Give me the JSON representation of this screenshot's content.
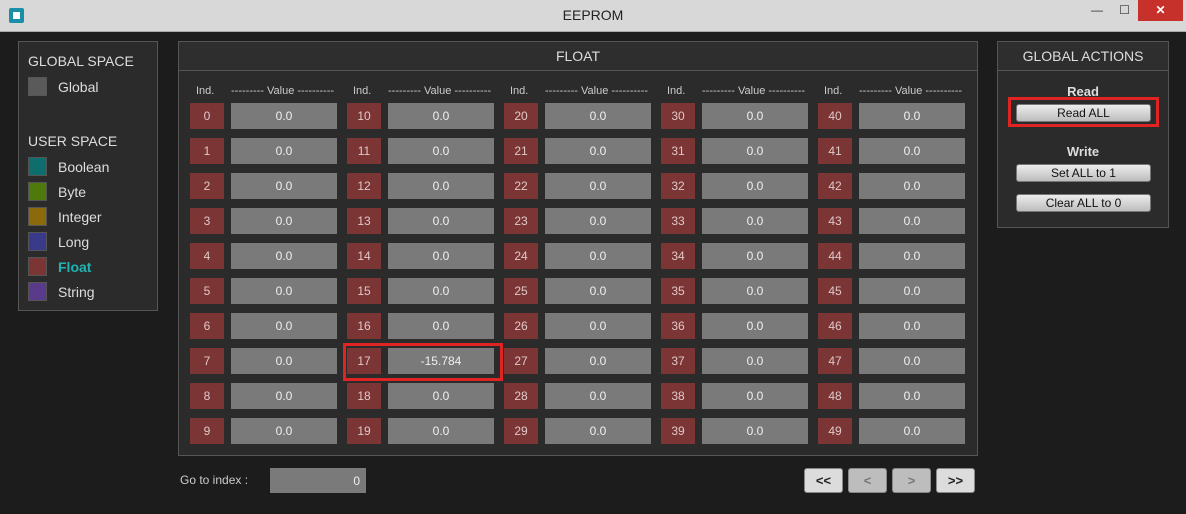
{
  "window": {
    "title": "EEPROM",
    "min_glyph": "—",
    "max_glyph": "☐",
    "close_glyph": "✕"
  },
  "left": {
    "global_title": "GLOBAL SPACE",
    "global_items": [
      {
        "label": "Global",
        "color": "#5a5a5a"
      }
    ],
    "user_title": "USER SPACE",
    "user_items": [
      {
        "label": "Boolean",
        "color": "#0e6e6e"
      },
      {
        "label": "Byte",
        "color": "#4e7a0c"
      },
      {
        "label": "Integer",
        "color": "#8a6a0a"
      },
      {
        "label": "Long",
        "color": "#3a3a8a"
      },
      {
        "label": "Float",
        "color": "#7b3535",
        "active": true
      },
      {
        "label": "String",
        "color": "#5a3a8a"
      }
    ]
  },
  "float_panel": {
    "title": "FLOAT",
    "col_ind_header": "Ind.",
    "col_value_header": "--------- Value ----------",
    "columns": [
      {
        "ind": [
          "0",
          "1",
          "2",
          "3",
          "4",
          "5",
          "6",
          "7",
          "8",
          "9"
        ],
        "values": [
          "0.0",
          "0.0",
          "0.0",
          "0.0",
          "0.0",
          "0.0",
          "0.0",
          "0.0",
          "0.0",
          "0.0"
        ]
      },
      {
        "ind": [
          "10",
          "11",
          "12",
          "13",
          "14",
          "15",
          "16",
          "17",
          "18",
          "19"
        ],
        "values": [
          "0.0",
          "0.0",
          "0.0",
          "0.0",
          "0.0",
          "0.0",
          "0.0",
          "-15.784",
          "0.0",
          "0.0"
        ]
      },
      {
        "ind": [
          "20",
          "21",
          "22",
          "23",
          "24",
          "25",
          "26",
          "27",
          "28",
          "29"
        ],
        "values": [
          "0.0",
          "0.0",
          "0.0",
          "0.0",
          "0.0",
          "0.0",
          "0.0",
          "0.0",
          "0.0",
          "0.0"
        ]
      },
      {
        "ind": [
          "30",
          "31",
          "32",
          "33",
          "34",
          "35",
          "36",
          "37",
          "38",
          "39"
        ],
        "values": [
          "0.0",
          "0.0",
          "0.0",
          "0.0",
          "0.0",
          "0.0",
          "0.0",
          "0.0",
          "0.0",
          "0.0"
        ]
      },
      {
        "ind": [
          "40",
          "41",
          "42",
          "43",
          "44",
          "45",
          "46",
          "47",
          "48",
          "49"
        ],
        "values": [
          "0.0",
          "0.0",
          "0.0",
          "0.0",
          "0.0",
          "0.0",
          "0.0",
          "0.0",
          "0.0",
          "0.0"
        ]
      }
    ]
  },
  "navigation": {
    "goto_label": "Go to index :",
    "goto_value": "0",
    "first": "<<",
    "prev": "<",
    "next": ">",
    "last": ">>"
  },
  "actions": {
    "title": "GLOBAL ACTIONS",
    "read_title": "Read",
    "read_all": "Read ALL",
    "write_title": "Write",
    "set_all": "Set ALL to 1",
    "clear_all": "Clear ALL to 0"
  },
  "colors": {
    "index_cell": "#7b3535",
    "value_cell": "#7a7a7a",
    "highlight": "#e02424",
    "active_label": "#1fb5b5"
  }
}
